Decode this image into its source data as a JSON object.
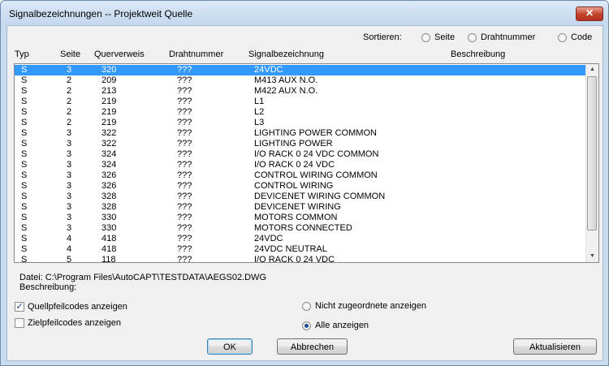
{
  "window": {
    "title": "Signalbezeichnungen -- Projektweit Quelle",
    "close_symbol": "✕"
  },
  "sort": {
    "label": "Sortieren:",
    "options": [
      {
        "label": "Seite",
        "selected": false
      },
      {
        "label": "Drahtnummer",
        "selected": false
      },
      {
        "label": "Code",
        "selected": false
      }
    ]
  },
  "columns": [
    "Typ",
    "Seite",
    "Querverweis",
    "Drahtnummer",
    "Signalbezeichnung",
    "Beschreibung"
  ],
  "rows": [
    {
      "typ": "S",
      "seite": "3",
      "ref": "320",
      "draht": "???",
      "signal": "24VDC",
      "beschr": "",
      "selected": true
    },
    {
      "typ": "S",
      "seite": "2",
      "ref": "209",
      "draht": "???",
      "signal": "M413 AUX N.O.",
      "beschr": ""
    },
    {
      "typ": "S",
      "seite": "2",
      "ref": "213",
      "draht": "???",
      "signal": "M422 AUX N.O.",
      "beschr": ""
    },
    {
      "typ": "S",
      "seite": "2",
      "ref": "219",
      "draht": "???",
      "signal": "L1",
      "beschr": ""
    },
    {
      "typ": "S",
      "seite": "2",
      "ref": "219",
      "draht": "???",
      "signal": "L2",
      "beschr": ""
    },
    {
      "typ": "S",
      "seite": "2",
      "ref": "219",
      "draht": "???",
      "signal": "L3",
      "beschr": ""
    },
    {
      "typ": "S",
      "seite": "3",
      "ref": "322",
      "draht": "???",
      "signal": "LIGHTING POWER COMMON",
      "beschr": ""
    },
    {
      "typ": "S",
      "seite": "3",
      "ref": "322",
      "draht": "???",
      "signal": "LIGHTING POWER",
      "beschr": ""
    },
    {
      "typ": "S",
      "seite": "3",
      "ref": "324",
      "draht": "???",
      "signal": "I/O RACK 0 24 VDC COMMON",
      "beschr": ""
    },
    {
      "typ": "S",
      "seite": "3",
      "ref": "324",
      "draht": "???",
      "signal": "I/O RACK 0 24 VDC",
      "beschr": ""
    },
    {
      "typ": "S",
      "seite": "3",
      "ref": "326",
      "draht": "???",
      "signal": "CONTROL WIRING COMMON",
      "beschr": ""
    },
    {
      "typ": "S",
      "seite": "3",
      "ref": "326",
      "draht": "???",
      "signal": "CONTROL WIRING",
      "beschr": ""
    },
    {
      "typ": "S",
      "seite": "3",
      "ref": "328",
      "draht": "???",
      "signal": "DEVICENET WIRING COMMON",
      "beschr": ""
    },
    {
      "typ": "S",
      "seite": "3",
      "ref": "328",
      "draht": "???",
      "signal": "DEVICENET WIRING",
      "beschr": ""
    },
    {
      "typ": "S",
      "seite": "3",
      "ref": "330",
      "draht": "???",
      "signal": "MOTORS COMMON",
      "beschr": ""
    },
    {
      "typ": "S",
      "seite": "3",
      "ref": "330",
      "draht": "???",
      "signal": "MOTORS CONNECTED",
      "beschr": ""
    },
    {
      "typ": "S",
      "seite": "4",
      "ref": "418",
      "draht": "???",
      "signal": "24VDC",
      "beschr": ""
    },
    {
      "typ": "S",
      "seite": "4",
      "ref": "418",
      "draht": "???",
      "signal": "24VDC NEUTRAL",
      "beschr": ""
    },
    {
      "typ": "S",
      "seite": "5",
      "ref": "118",
      "draht": "???",
      "signal": "I/O RACK 0 24 VDC",
      "beschr": ""
    }
  ],
  "info": {
    "file": "Datei: C:\\Program Files\\AutoCAPT\\TESTDATA\\AEGS02.DWG",
    "description": "Beschreibung:"
  },
  "checkboxes": [
    {
      "label": "Quellpfeilcodes anzeigen",
      "checked": true
    },
    {
      "label": "Zielpfeilcodes anzeigen",
      "checked": false
    }
  ],
  "filter": [
    {
      "label": "Nicht zugeordnete anzeigen",
      "selected": false
    },
    {
      "label": "Alle anzeigen",
      "selected": true
    }
  ],
  "buttons": {
    "ok": "OK",
    "cancel": "Abbrechen",
    "refresh": "Aktualisieren"
  },
  "scroll": {
    "up": "▲",
    "down": "▼"
  }
}
